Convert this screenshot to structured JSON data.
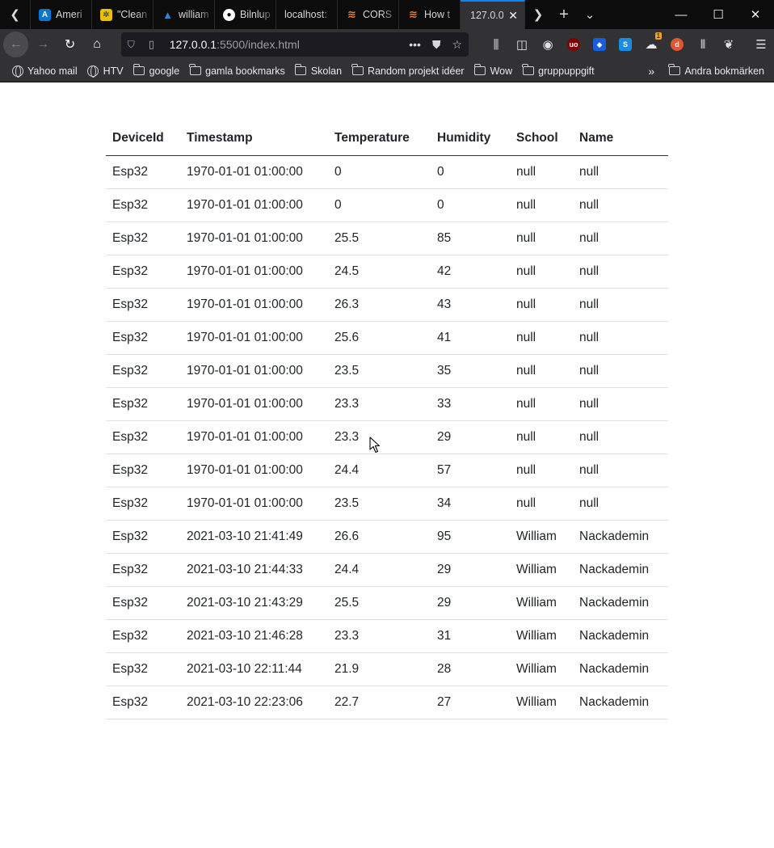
{
  "browser": {
    "tabs": [
      {
        "label": "Ameri",
        "icon": "azure-icon",
        "color": "#0078d4"
      },
      {
        "label": "\"Clean",
        "icon": "clean-code-icon",
        "color": "#e8c200"
      },
      {
        "label": "william",
        "icon": "azure-devops-icon",
        "color": "#0078d4"
      },
      {
        "label": "Bilnlup",
        "icon": "github-icon",
        "color": "#ffffff"
      },
      {
        "label": "localhost:",
        "icon": "",
        "color": ""
      },
      {
        "label": "CORS",
        "icon": "stackoverflow-icon",
        "color": "#f48024"
      },
      {
        "label": "How t",
        "icon": "stackoverflow-icon",
        "color": "#f48024"
      }
    ],
    "active_tab": {
      "label": "127.0.0",
      "close": "✕"
    },
    "url_host": "127.0.0.1",
    "url_path": ":5500/index.html",
    "extension_badge": "1"
  },
  "bookmarks": {
    "items": [
      {
        "label": "Yahoo mail",
        "icon": "globe-icon"
      },
      {
        "label": "HTV",
        "icon": "globe-icon"
      },
      {
        "label": "google",
        "icon": "folder-icon"
      },
      {
        "label": "gamla bookmarks",
        "icon": "folder-icon"
      },
      {
        "label": "Skolan",
        "icon": "folder-icon"
      },
      {
        "label": "Random projekt idéer",
        "icon": "folder-icon"
      },
      {
        "label": "Wow",
        "icon": "folder-icon"
      },
      {
        "label": "gruppuppgift",
        "icon": "folder-icon"
      }
    ],
    "other": "Andra bokmärken"
  },
  "table": {
    "headers": [
      "DeviceId",
      "Timestamp",
      "Temperature",
      "Humidity",
      "School",
      "Name"
    ],
    "rows": [
      [
        "Esp32",
        "1970-01-01 01:00:00",
        "0",
        "0",
        "null",
        "null"
      ],
      [
        "Esp32",
        "1970-01-01 01:00:00",
        "0",
        "0",
        "null",
        "null"
      ],
      [
        "Esp32",
        "1970-01-01 01:00:00",
        "25.5",
        "85",
        "null",
        "null"
      ],
      [
        "Esp32",
        "1970-01-01 01:00:00",
        "24.5",
        "42",
        "null",
        "null"
      ],
      [
        "Esp32",
        "1970-01-01 01:00:00",
        "26.3",
        "43",
        "null",
        "null"
      ],
      [
        "Esp32",
        "1970-01-01 01:00:00",
        "25.6",
        "41",
        "null",
        "null"
      ],
      [
        "Esp32",
        "1970-01-01 01:00:00",
        "23.5",
        "35",
        "null",
        "null"
      ],
      [
        "Esp32",
        "1970-01-01 01:00:00",
        "23.3",
        "33",
        "null",
        "null"
      ],
      [
        "Esp32",
        "1970-01-01 01:00:00",
        "23.3",
        "29",
        "null",
        "null"
      ],
      [
        "Esp32",
        "1970-01-01 01:00:00",
        "24.4",
        "57",
        "null",
        "null"
      ],
      [
        "Esp32",
        "1970-01-01 01:00:00",
        "23.5",
        "34",
        "null",
        "null"
      ],
      [
        "Esp32",
        "2021-03-10 21:41:49",
        "26.6",
        "95",
        "William",
        "Nackademin"
      ],
      [
        "Esp32",
        "2021-03-10 21:44:33",
        "24.4",
        "29",
        "William",
        "Nackademin"
      ],
      [
        "Esp32",
        "2021-03-10 21:43:29",
        "25.5",
        "29",
        "William",
        "Nackademin"
      ],
      [
        "Esp32",
        "2021-03-10 21:46:28",
        "23.3",
        "31",
        "William",
        "Nackademin"
      ],
      [
        "Esp32",
        "2021-03-10 22:11:44",
        "21.9",
        "28",
        "William",
        "Nackademin"
      ],
      [
        "Esp32",
        "2021-03-10 22:23:06",
        "22.7",
        "27",
        "William",
        "Nackademin"
      ]
    ]
  }
}
